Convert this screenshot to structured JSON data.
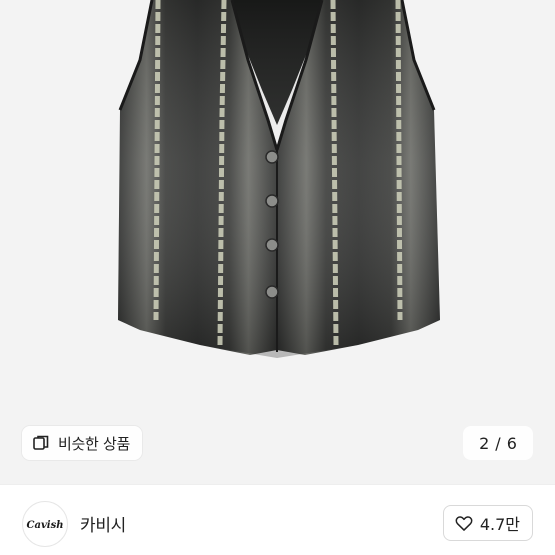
{
  "product_image": {
    "alt_subject": "denim-vest-photo"
  },
  "similar_products": {
    "label": "비슷한 상품",
    "icon": "similar-items-icon"
  },
  "image_pager": {
    "current": "2",
    "separator": "/",
    "total": "6"
  },
  "seller": {
    "name": "카비시",
    "logo_text": "Cavish"
  },
  "like": {
    "icon": "heart-icon",
    "count": "4.7만"
  },
  "colors": {
    "background": "#ffffff",
    "text": "#222222",
    "denim": "#3a3b3a",
    "stripe": "#c9cbb6"
  }
}
